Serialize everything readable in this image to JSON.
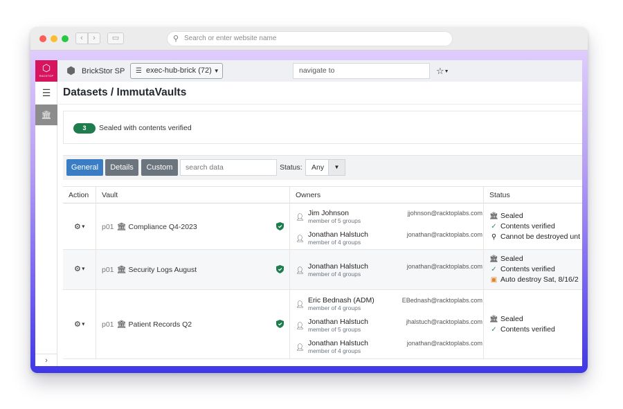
{
  "browser": {
    "url_placeholder": "Search or enter website name",
    "back": "‹",
    "forward": "›"
  },
  "brand": {
    "logo_text": "RACKTOP",
    "product_name": "BrickStor SP",
    "hub_selector": "exec-hub-brick (72)",
    "navigate_placeholder": "navigate to"
  },
  "page": {
    "title": "Datasets / ImmutaVaults"
  },
  "summary": {
    "count": "3",
    "label": "Sealed with contents verified"
  },
  "filters": {
    "tabs": [
      "General",
      "Details",
      "Custom"
    ],
    "search_placeholder": "search data",
    "status_label": "Status:",
    "status_value": "Any"
  },
  "table": {
    "columns": [
      "Action",
      "Vault",
      "Owners",
      "Status"
    ],
    "rows": [
      {
        "pool": "p01",
        "vault": "Compliance Q4-2023",
        "owners": [
          {
            "name": "Jim Johnson",
            "groups": "member of 5 groups",
            "email": "jjohnson@racktoplabs.com"
          },
          {
            "name": "Jonathan Halstuch",
            "groups": "member of 4 groups",
            "email": "jonathan@racktoplabs.com"
          }
        ],
        "status": [
          {
            "icon": "bank-icon",
            "text": "Sealed"
          },
          {
            "icon": "check-circle-icon",
            "text": "Contents verified"
          },
          {
            "icon": "pin-icon",
            "text": "Cannot be destroyed unt"
          }
        ]
      },
      {
        "pool": "p01",
        "vault": "Security Logs August",
        "owners": [
          {
            "name": "Jonathan Halstuch",
            "groups": "member of 4 groups",
            "email": "jonathan@racktoplabs.com"
          }
        ],
        "status": [
          {
            "icon": "bank-icon",
            "text": "Sealed"
          },
          {
            "icon": "check-circle-icon",
            "text": "Contents verified"
          },
          {
            "icon": "calendar-clock-icon",
            "text": "Auto destroy Sat, 8/16/2"
          }
        ]
      },
      {
        "pool": "p01",
        "vault": "Patient Records Q2",
        "owners": [
          {
            "name": "Eric Bednash (ADM)",
            "groups": "member of 4 groups",
            "email": "EBednash@racktoplabs.com"
          },
          {
            "name": "Jonathan Halstuch",
            "groups": "member of 5 groups",
            "email": "jhalstuch@racktoplabs.com"
          },
          {
            "name": "Jonathan Halstuch",
            "groups": "member of 4 groups",
            "email": "jonathan@racktoplabs.com"
          }
        ],
        "status": [
          {
            "icon": "bank-icon",
            "text": "Sealed"
          },
          {
            "icon": "check-circle-icon",
            "text": "Contents verified"
          }
        ]
      }
    ]
  },
  "colors": {
    "brand_pink": "#d7145e",
    "primary_blue": "#3b7dc4",
    "success_green": "#1f7d4d",
    "secondary_gray": "#6c757d"
  }
}
